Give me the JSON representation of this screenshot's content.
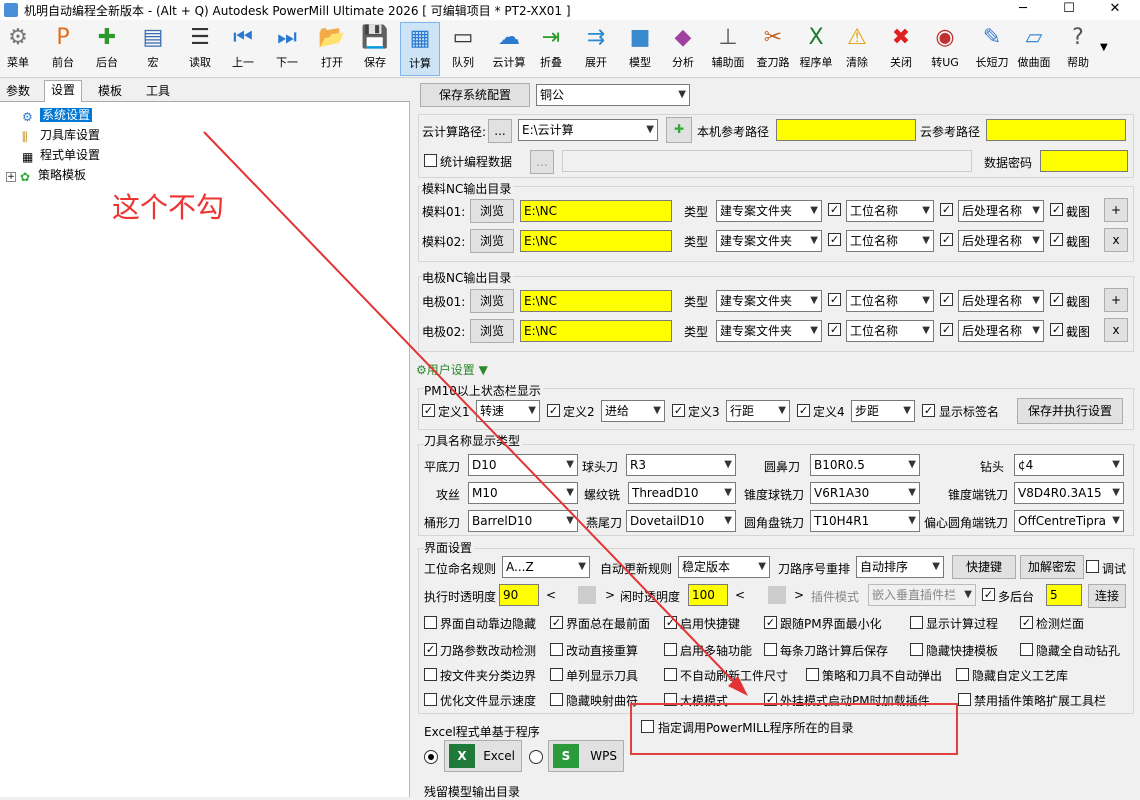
{
  "titlebar": {
    "title": "机明自动编程全新版本 - (Alt + Q) Autodesk PowerMill Ultimate 2026   [ 可编辑项目 * PT2-XX01 ]",
    "min": "─",
    "max": "☐",
    "close": "✕"
  },
  "toolbar": [
    {
      "label": "菜单",
      "icon": "gear-icon",
      "glyph": "⚙"
    },
    {
      "label": "前台",
      "icon": "pm-app-icon",
      "glyph": "P"
    },
    {
      "label": "后台",
      "icon": "plus-icon",
      "glyph": "✚"
    },
    {
      "label": "宏",
      "icon": "macro-icon",
      "glyph": "▤"
    },
    {
      "label": "读取",
      "icon": "sliders-icon",
      "glyph": "☰"
    },
    {
      "label": "上一",
      "icon": "prev-icon",
      "glyph": "⏮"
    },
    {
      "label": "下一",
      "icon": "next-icon",
      "glyph": "⏭"
    },
    {
      "label": "打开",
      "icon": "folder-icon",
      "glyph": "📂"
    },
    {
      "label": "保存",
      "icon": "save-icon",
      "glyph": "💾"
    },
    {
      "label": "计算",
      "icon": "calculator-icon",
      "glyph": "▦"
    },
    {
      "label": "队列",
      "icon": "queue-icon",
      "glyph": "▭"
    },
    {
      "label": "云计算",
      "icon": "cloud-icon",
      "glyph": "☁"
    },
    {
      "label": "折叠",
      "icon": "collapse-icon",
      "glyph": "⇥"
    },
    {
      "label": "展开",
      "icon": "expand-icon",
      "glyph": "⇉"
    },
    {
      "label": "模型",
      "icon": "cube-icon",
      "glyph": "■"
    },
    {
      "label": "分析",
      "icon": "analyze-icon",
      "glyph": "◆"
    },
    {
      "label": "辅助面",
      "icon": "aux-surface-icon",
      "glyph": "⊥"
    },
    {
      "label": "查刀路",
      "icon": "tools-icon",
      "glyph": "✂"
    },
    {
      "label": "程序单",
      "icon": "excel-icon",
      "glyph": "X"
    },
    {
      "label": "清除",
      "icon": "warning-icon",
      "glyph": "⚠"
    },
    {
      "label": "关闭",
      "icon": "close-circle-icon",
      "glyph": "✖"
    },
    {
      "label": "转UG",
      "icon": "ug-icon",
      "glyph": "◉"
    },
    {
      "label": "长短刀",
      "icon": "tool-length-icon",
      "glyph": "✎"
    },
    {
      "label": "做曲面",
      "icon": "surface-icon",
      "glyph": "▱"
    },
    {
      "label": "帮助",
      "icon": "help-icon",
      "glyph": "?"
    }
  ],
  "left": {
    "tabs": [
      "参数",
      "设置",
      "模板",
      "工具"
    ],
    "tree": [
      "系统设置",
      "刀具库设置",
      "程式单设置",
      "策略模板"
    ],
    "annotation": "这个不勾"
  },
  "right": {
    "save_config": "保存系统配置",
    "material": "铜公",
    "cloud_path_label": "云计算路径:",
    "browse_dots": "...",
    "cloud_path": "E:\\云计算",
    "local_ref_label": "本机参考路径",
    "cloud_ref_label": "云参考路径",
    "stats_label": "统计编程数据",
    "data_pwd_label": "数据密码",
    "mold_section": "模料NC输出目录",
    "electrode_section": "电极NC输出目录",
    "browse": "浏览",
    "type_label": "类型",
    "type_value": "建专案文件夹",
    "pos_name": "工位名称",
    "post_name": "后处理名称",
    "screenshot": "截图",
    "plus": "+",
    "x": "x",
    "mold_rows": [
      {
        "label": "模料01:",
        "path": "E:\\NC"
      },
      {
        "label": "模料02:",
        "path": "E:\\NC"
      }
    ],
    "elec_rows": [
      {
        "label": "电极01:",
        "path": "E:\\NC"
      },
      {
        "label": "电极02:",
        "path": "E:\\NC"
      }
    ],
    "user_settings": "用户设置",
    "status_section": "PM10以上状态栏显示",
    "status": [
      {
        "label": "定义1",
        "value": "转速"
      },
      {
        "label": "定义2",
        "value": "进给"
      },
      {
        "label": "定义3",
        "value": "行距"
      },
      {
        "label": "定义4",
        "value": "步距"
      }
    ],
    "show_sign": "显示标签名",
    "save_exec": "保存并执行设置",
    "toolname_section": "刀具名称显示类型",
    "tools_row1": [
      {
        "label": "平底刀",
        "value": "D10"
      },
      {
        "label": "球头刀",
        "value": "R3"
      },
      {
        "label": "圆鼻刀",
        "value": "B10R0.5"
      },
      {
        "label": "钻头",
        "value": "¢4"
      }
    ],
    "tools_row2": [
      {
        "label": "攻丝",
        "value": "M10"
      },
      {
        "label": "螺纹铣",
        "value": "ThreadD10"
      },
      {
        "label": "锥度球铣刀",
        "value": "V6R1A30"
      },
      {
        "label": "锥度端铣刀",
        "value": "V8D4R0.3A15"
      }
    ],
    "tools_row3": [
      {
        "label": "桶形刀",
        "value": "BarrelD10"
      },
      {
        "label": "燕尾刀",
        "value": "DovetailD10"
      },
      {
        "label": "圆角盘铣刀",
        "value": "T10H4R1"
      },
      {
        "label": "偏心圆角端铣刀",
        "value": "OffCentreTipra"
      }
    ],
    "ui_section": "界面设置",
    "naming_label": "工位命名规则",
    "naming_value": "A...Z",
    "update_label": "自动更新规则",
    "update_value": "稳定版本",
    "reorder_label": "刀路序号重排",
    "reorder_value": "自动排序",
    "shortcut": "快捷键",
    "encrypt": "加解密宏",
    "debug": "调试",
    "exec_trans_label": "执行时透明度",
    "exec_trans": "90",
    "idle_trans_label": "闲时透明度",
    "idle_trans": "100",
    "plugin_mode_label": "插件模式",
    "plugin_mode": "嵌入垂直插件栏",
    "multi_bg": "多后台",
    "multi_bg_val": "5",
    "connect": "连接",
    "lt": "<",
    "gt": ">",
    "checks": [
      [
        {
          "t": "界面自动靠边隐藏",
          "c": false
        },
        {
          "t": "界面总在最前面",
          "c": true
        },
        {
          "t": "启用快捷键",
          "c": true
        },
        {
          "t": "跟随PM界面最小化",
          "c": true
        },
        {
          "t": "显示计算过程",
          "c": false
        },
        {
          "t": "检测烂面",
          "c": true
        }
      ],
      [
        {
          "t": "刀路参数改动检测",
          "c": true
        },
        {
          "t": "改动直接重算",
          "c": false
        },
        {
          "t": "启用多轴功能",
          "c": false
        },
        {
          "t": "每条刀路计算后保存",
          "c": false
        },
        {
          "t": "隐藏快捷模板",
          "c": false
        },
        {
          "t": "隐藏全自动钻孔",
          "c": false
        }
      ],
      [
        {
          "t": "按文件夹分类边界",
          "c": false
        },
        {
          "t": "单列显示刀具",
          "c": false
        },
        {
          "t": "不自动刷新工件尺寸",
          "c": false
        },
        {
          "t": "策略和刀具不自动弹出",
          "c": false
        },
        {
          "t": "隐藏自定义工艺库",
          "c": false
        }
      ],
      [
        {
          "t": "优化文件显示速度",
          "c": false
        },
        {
          "t": "隐藏映射曲符",
          "c": false
        },
        {
          "t": "大模模式",
          "c": false
        },
        {
          "t": "外挂模式启动PM时加载插件",
          "c": true
        },
        {
          "t": "禁用插件策略扩展工具栏",
          "c": false
        }
      ]
    ],
    "pm_dir": "指定调用PowerMILL程序所在的目录",
    "excel_section": "Excel程式单基于程序",
    "excel": "Excel",
    "wps": "WPS",
    "residual_section": "残留模型输出目录"
  },
  "colors": {
    "highlight": "#ffff00",
    "annotation": "#e33333",
    "selected_tab": "#cde4f7"
  }
}
